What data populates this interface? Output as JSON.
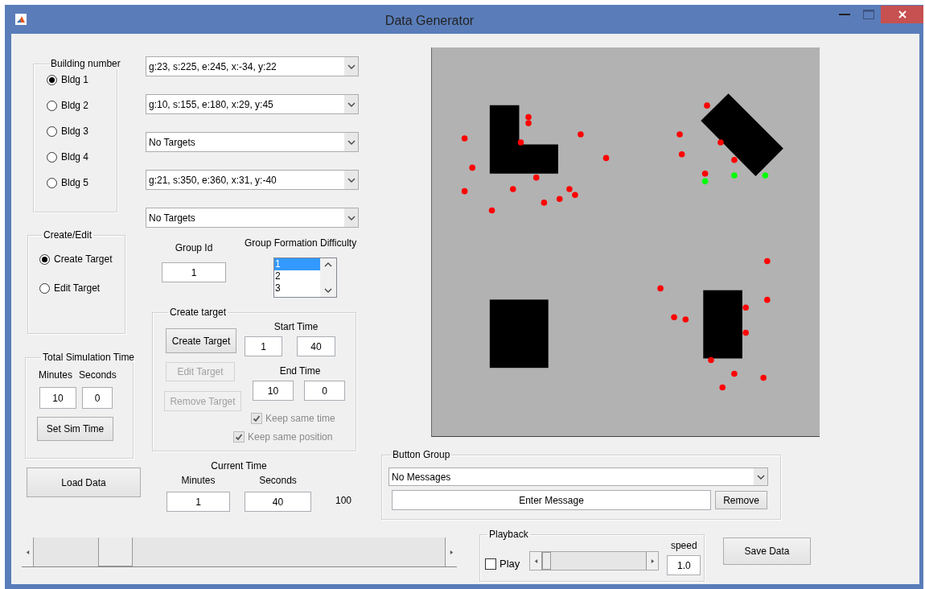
{
  "window": {
    "title": "Data Generator"
  },
  "building_number": {
    "title": "Building number",
    "options": [
      {
        "label": "Bldg 1",
        "selected": true
      },
      {
        "label": "Bldg 2",
        "selected": false
      },
      {
        "label": "Bldg 3",
        "selected": false
      },
      {
        "label": "Bldg 4",
        "selected": false
      },
      {
        "label": "Bldg 5",
        "selected": false
      }
    ]
  },
  "create_edit": {
    "title": "Create/Edit",
    "options": [
      {
        "label": "Create Target",
        "selected": true
      },
      {
        "label": "Edit Target",
        "selected": false
      }
    ]
  },
  "total_simulation_time": {
    "title": "Total Simulation Time",
    "minutes_label": "Minutes",
    "seconds_label": "Seconds",
    "minutes": "10",
    "seconds": "0",
    "button": "Set Sim Time"
  },
  "load_button": "Load Data",
  "target_dropdowns": [
    {
      "value": "g:23, s:225, e:245, x:-34, y:22"
    },
    {
      "value": "g:10, s:155, e:180, x:29, y:45"
    },
    {
      "value": "No Targets"
    },
    {
      "value": "g:21, s:350, e:360, x:31, y:-40"
    },
    {
      "value": "No Targets"
    }
  ],
  "group_id": {
    "label": "Group Id",
    "value": "1"
  },
  "group_formation_difficulty": {
    "label": "Group Formation Difficulty",
    "items": [
      {
        "label": "1",
        "selected": true
      },
      {
        "label": "2",
        "selected": false
      },
      {
        "label": "3",
        "selected": false
      }
    ]
  },
  "create_target": {
    "title": "Create target",
    "buttons": [
      {
        "label": "Create Target",
        "disabled": false
      },
      {
        "label": "Edit Target",
        "disabled": true
      },
      {
        "label": "Remove Target",
        "disabled": true
      }
    ],
    "start_time_label": "Start Time",
    "start_minutes": "1",
    "start_seconds": "40",
    "end_time_label": "End Time",
    "end_minutes": "10",
    "end_seconds": "0",
    "options": [
      {
        "label": "Keep same time",
        "checked": true,
        "disabled": true
      },
      {
        "label": "Keep same position",
        "checked": true,
        "disabled": true
      }
    ]
  },
  "current_time": {
    "title": "Current Time",
    "minutes_label": "Minutes",
    "seconds_label": "Seconds",
    "minutes": "1",
    "seconds": "40",
    "total": "100"
  },
  "map": {
    "targets": [
      {
        "color": "#ff0000"
      },
      {
        "color": "#ff0000"
      },
      {
        "color": "#ff0000"
      },
      {
        "color": "#ff0000"
      },
      {
        "color": "#ff0000"
      },
      {
        "color": "#ff0000"
      },
      {
        "color": "#ff0000"
      },
      {
        "color": "#ff0000"
      },
      {
        "color": "#ff0000"
      },
      {
        "color": "#ff0000"
      },
      {
        "color": "#ff0000"
      },
      {
        "color": "#ff0000"
      },
      {
        "color": "#ff0000"
      },
      {
        "color": "#ff0000"
      },
      {
        "color": "#ff0000"
      },
      {
        "color": "#ff0000"
      },
      {
        "color": "#ff0000"
      },
      {
        "color": "#ff0000"
      },
      {
        "color": "#ff0000"
      },
      {
        "color": "#ff0000"
      },
      {
        "color": "#ff0000"
      },
      {
        "color": "#00ff00"
      },
      {
        "color": "#00ff00"
      },
      {
        "color": "#00ff00"
      },
      {
        "color": "#ff0000"
      },
      {
        "color": "#ff0000"
      },
      {
        "color": "#ff0000"
      },
      {
        "color": "#ff0000"
      },
      {
        "color": "#ff0000"
      },
      {
        "color": "#ff0000"
      },
      {
        "color": "#ff0000"
      },
      {
        "color": "#ff0000"
      },
      {
        "color": "#ff0000"
      },
      {
        "color": "#ff0000"
      },
      {
        "color": "#ff0000"
      }
    ]
  },
  "button_group": {
    "title": "Button Group",
    "messages": "No Messages",
    "message_field": "Enter Message",
    "remove": "Remove"
  },
  "playback": {
    "title": "Playback",
    "play": {
      "label": "Play",
      "checked": false
    },
    "level": 0,
    "speed_label": "speed",
    "speed": "1.0"
  },
  "save_button": "Save Data"
}
